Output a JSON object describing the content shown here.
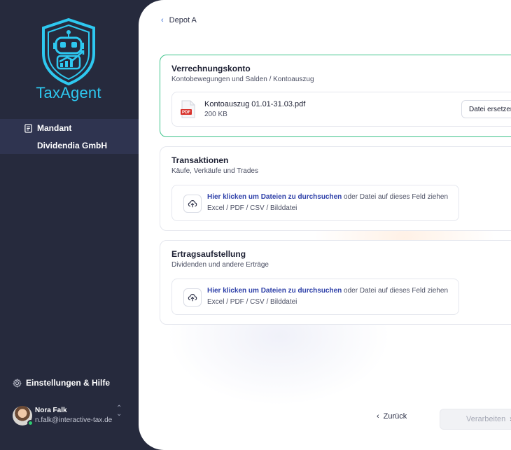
{
  "brand": {
    "name": "TaxAgent",
    "accent": "#2ec8f0"
  },
  "sidebar": {
    "nav_item": {
      "icon": "document-list-icon",
      "label": "Mandant"
    },
    "nav_sub": {
      "label": "Dividendia GmbH"
    },
    "settings": {
      "icon": "gear-icon",
      "label": "Einstellungen & Hilfe"
    },
    "user": {
      "name": "Nora Falk",
      "email": "n.falk@interactive-tax.de",
      "status_color": "#2ecc71"
    }
  },
  "breadcrumb": {
    "back_icon": "chevron-left-icon",
    "label": "Depot A"
  },
  "cards": [
    {
      "title": "Verrechnungskonto",
      "subtitle": "Kontobewegungen und Salden / Kontoauszug",
      "file": {
        "icon": "pdf-file-icon",
        "badge": "PDF",
        "name": "Kontoauszug 01.01-31.03.pdf",
        "size": "200 KB",
        "replace_label": "Datei ersetzen"
      }
    },
    {
      "title": "Transaktionen",
      "subtitle": "Käufe, Verkäufe und Trades",
      "upload": {
        "icon": "cloud-upload-icon",
        "link": "Hier klicken um Dateien zu durchsuchen",
        "rest": " oder Datei auf dieses Feld ziehen",
        "formats": "Excel / PDF / CSV / Bilddatei"
      }
    },
    {
      "title": "Ertragsaufstellung",
      "subtitle": "Dividenden und andere Erträge",
      "upload": {
        "icon": "cloud-upload-icon",
        "link": "Hier klicken um Dateien zu durchsuchen",
        "rest": " oder Datei auf dieses Feld ziehen",
        "formats": "Excel / PDF / CSV / Bilddatei"
      }
    }
  ],
  "footer": {
    "back_label": "Zurück",
    "process_label": "Verarbeiten"
  }
}
